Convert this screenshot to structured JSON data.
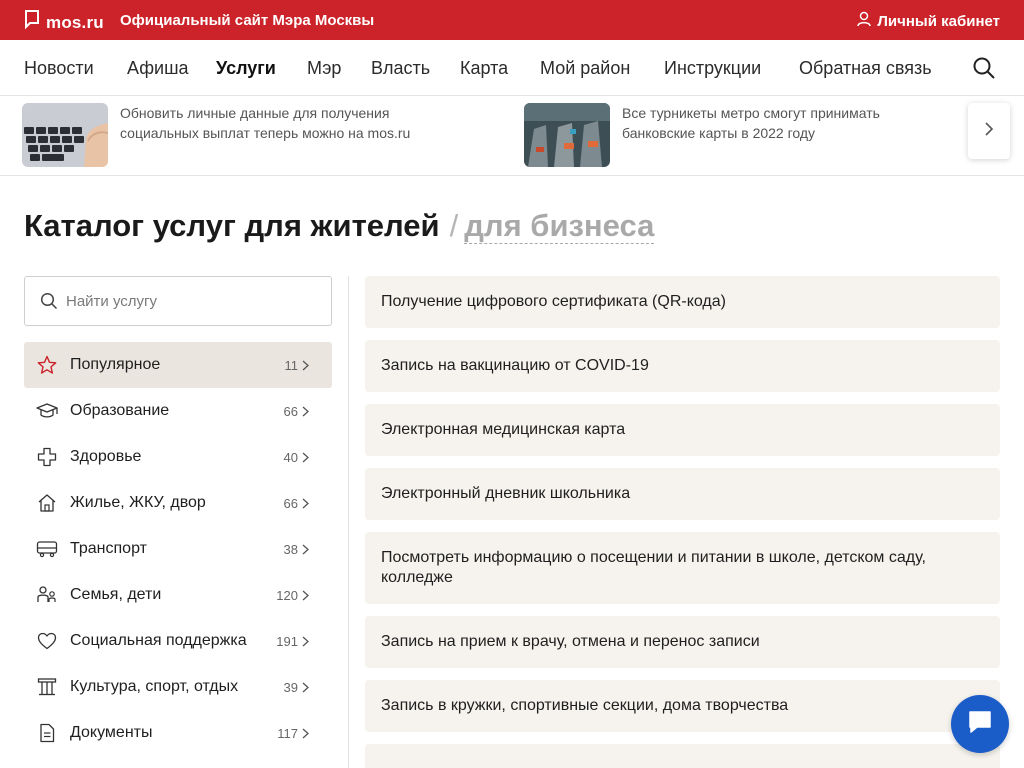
{
  "header": {
    "logo_text": "mos.ru",
    "subtitle": "Официальный сайт Мэра Москвы",
    "cabinet_label": "Личный кабинет",
    "brand_color": "#cc2229"
  },
  "nav": {
    "items": [
      "Новости",
      "Афиша",
      "Услуги",
      "Мэр",
      "Власть",
      "Карта",
      "Мой район",
      "Инструкции",
      "Обратная связь"
    ],
    "active": "Услуги"
  },
  "news": [
    {
      "text": "Обновить личные данные для получения социальных выплат теперь можно на mos.ru",
      "image": "keyboard-photo"
    },
    {
      "text": "Все турникеты метро смогут принимать банковские карты в 2022 году",
      "image": "metro-turnstiles-photo"
    }
  ],
  "catalog": {
    "title": "Каталог услуг для жителей",
    "separator": "/",
    "alt_link": "для бизнеса"
  },
  "search": {
    "placeholder": "Найти услугу"
  },
  "categories": [
    {
      "label": "Популярное",
      "count": "11",
      "icon": "star-icon",
      "active": true
    },
    {
      "label": "Образование",
      "count": "66",
      "icon": "graduation-cap-icon"
    },
    {
      "label": "Здоровье",
      "count": "40",
      "icon": "medical-cross-icon"
    },
    {
      "label": "Жилье, ЖКУ, двор",
      "count": "66",
      "icon": "house-icon"
    },
    {
      "label": "Транспорт",
      "count": "38",
      "icon": "bus-icon"
    },
    {
      "label": "Семья, дети",
      "count": "120",
      "icon": "family-icon"
    },
    {
      "label": "Социальная поддержка",
      "count": "191",
      "icon": "heart-icon"
    },
    {
      "label": "Культура, спорт, отдых",
      "count": "39",
      "icon": "museum-icon"
    },
    {
      "label": "Документы",
      "count": "117",
      "icon": "document-icon"
    }
  ],
  "services": [
    "Получение цифрового сертификата (QR-кода)",
    "Запись на вакцинацию от COVID-19",
    "Электронная медицинская карта",
    "Электронный дневник школьника",
    "Посмотреть информацию о посещении и питании в школе, детском саду, колледже",
    "Запись на прием к врачу, отмена и перенос записи",
    "Запись в кружки, спортивные секции, дома творчества"
  ],
  "chat": {
    "icon": "chat-bubble-icon",
    "color": "#1a5cc8"
  }
}
